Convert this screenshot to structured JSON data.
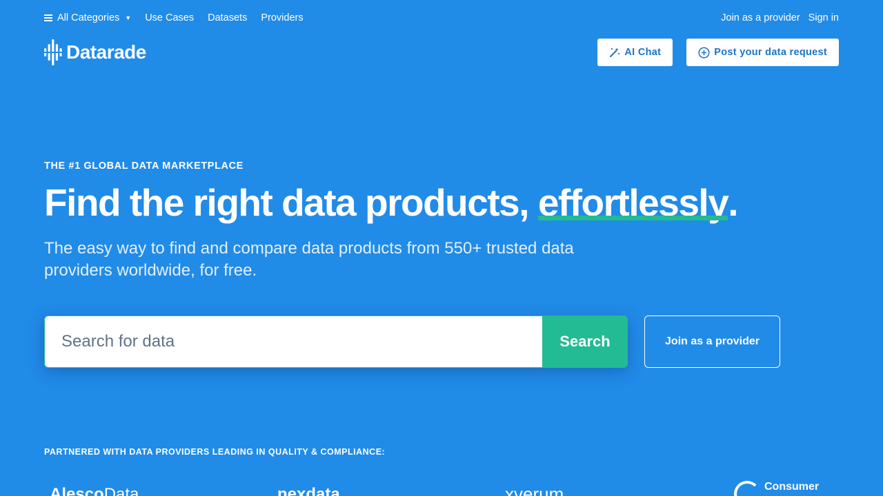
{
  "topnav": {
    "categories_label": "All Categories",
    "links": [
      "Use Cases",
      "Datasets",
      "Providers"
    ],
    "join_provider": "Join as a provider",
    "sign_in": "Sign in"
  },
  "header": {
    "logo_text": "Datarade",
    "ai_chat_label": "AI Chat",
    "post_request_label": "Post your data request"
  },
  "hero": {
    "eyebrow": "THE #1 GLOBAL DATA MARKETPLACE",
    "headline_prefix": "Find the right data products, ",
    "headline_emphasis": "effortlessly",
    "headline_suffix": ".",
    "subhead": "The easy way to find and compare data products from 550+ trusted data providers worldwide, for free."
  },
  "search": {
    "placeholder": "Search for data",
    "button_label": "Search",
    "join_button_label": "Join as a provider"
  },
  "partners": {
    "title": "PARTNERED WITH DATA PROVIDERS LEADING IN QUALITY & COMPLIANCE:",
    "logo1_a": "Alesco",
    "logo1_b": "Data",
    "logo2": "nexdata",
    "logo3": "xverum",
    "logo4": "Consumer"
  },
  "colors": {
    "background": "#218be8",
    "accent_green": "#23bb93",
    "button_text_blue": "#1b74c5"
  },
  "icons": [
    "menu-icon",
    "chevron-down-icon",
    "magic-wand-icon",
    "plus-circle-icon",
    "datarade-logo-icon"
  ]
}
